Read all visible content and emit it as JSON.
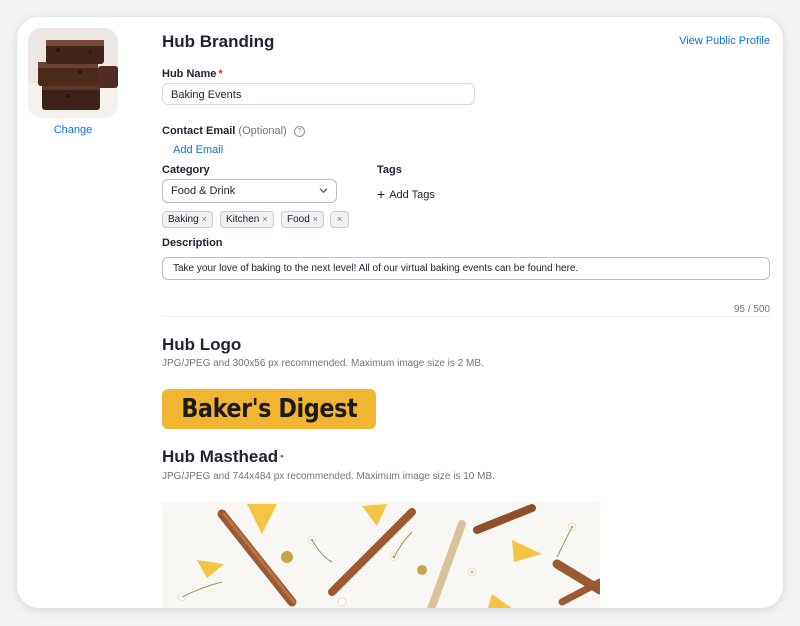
{
  "avatar": {
    "change_label": "Change"
  },
  "header": {
    "title": "Hub Branding",
    "view_public_label": "View Public Profile"
  },
  "form": {
    "hub_name_label": "Hub Name",
    "hub_name_required": "*",
    "hub_name_value": "Baking Events",
    "contact_email_label": "Contact Email",
    "contact_email_optional": "(Optional)",
    "help_icon": "?",
    "add_email_label": "Add Email",
    "category_label": "Category",
    "category_value": "Food & Drink",
    "tags_label": "Tags",
    "add_tags_label": "Add Tags",
    "chips": [
      {
        "label": "Baking"
      },
      {
        "label": "Kitchen"
      },
      {
        "label": "Food"
      },
      {
        "label": ""
      }
    ],
    "chip_remove": "×",
    "description_label": "Description",
    "description_value": "Take your love of baking to the next level! All of our virtual baking events can be found here.",
    "description_counter": "95 / 500"
  },
  "hub_logo": {
    "title": "Hub Logo",
    "hint": "JPG/JPEG and 300x56 px recommended. Maximum image size is 2 MB.",
    "logo_text": "Baker's Digest"
  },
  "hub_masthead": {
    "title": "Hub Masthead",
    "required_dot": "•",
    "hint": "JPG/JPEG and 744x484 px recommended. Maximum image size is 10 MB."
  },
  "colors": {
    "accent": "#0e72ed",
    "logo_bg": "#f1b532",
    "required": "#e02828"
  }
}
